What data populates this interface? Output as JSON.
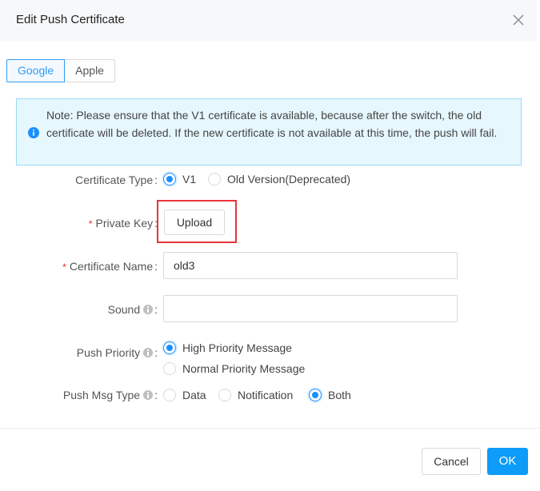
{
  "dialog": {
    "title": "Edit Push Certificate",
    "close_icon": "close-icon"
  },
  "tabs": [
    {
      "label": "Google",
      "active": true
    },
    {
      "label": "Apple",
      "active": false
    }
  ],
  "alert": {
    "icon": "info-icon",
    "text": "Note: Please ensure that the V1 certificate is available, because after the switch, the old certificate will be deleted. If the new certificate is not available at this time, the push will fail."
  },
  "form": {
    "certificate_type": {
      "label": "Certificate Type",
      "options": [
        {
          "label": "V1",
          "checked": true
        },
        {
          "label": "Old Version(Deprecated)",
          "checked": false
        }
      ]
    },
    "private_key": {
      "label": "Private Key",
      "required": "*",
      "button_label": "Upload"
    },
    "certificate_name": {
      "label": "Certificate Name",
      "required": "*",
      "value": "old3"
    },
    "sound": {
      "label": "Sound",
      "value": ""
    },
    "push_priority": {
      "label": "Push Priority",
      "options": [
        {
          "label": "High Priority Message",
          "checked": true
        },
        {
          "label": "Normal Priority Message",
          "checked": false
        }
      ]
    },
    "push_msg_type": {
      "label": "Push Msg Type",
      "options": [
        {
          "label": "Data",
          "checked": false
        },
        {
          "label": "Notification",
          "checked": false
        },
        {
          "label": "Both",
          "checked": true
        }
      ]
    },
    "colon": ":"
  },
  "footer": {
    "cancel_label": "Cancel",
    "ok_label": "OK"
  },
  "colors": {
    "primary": "#1890ff",
    "ok_button": "#0d9cf7",
    "highlight": "#e8343b",
    "alert_bg": "#e6f7fd",
    "required": "#f5222d"
  }
}
